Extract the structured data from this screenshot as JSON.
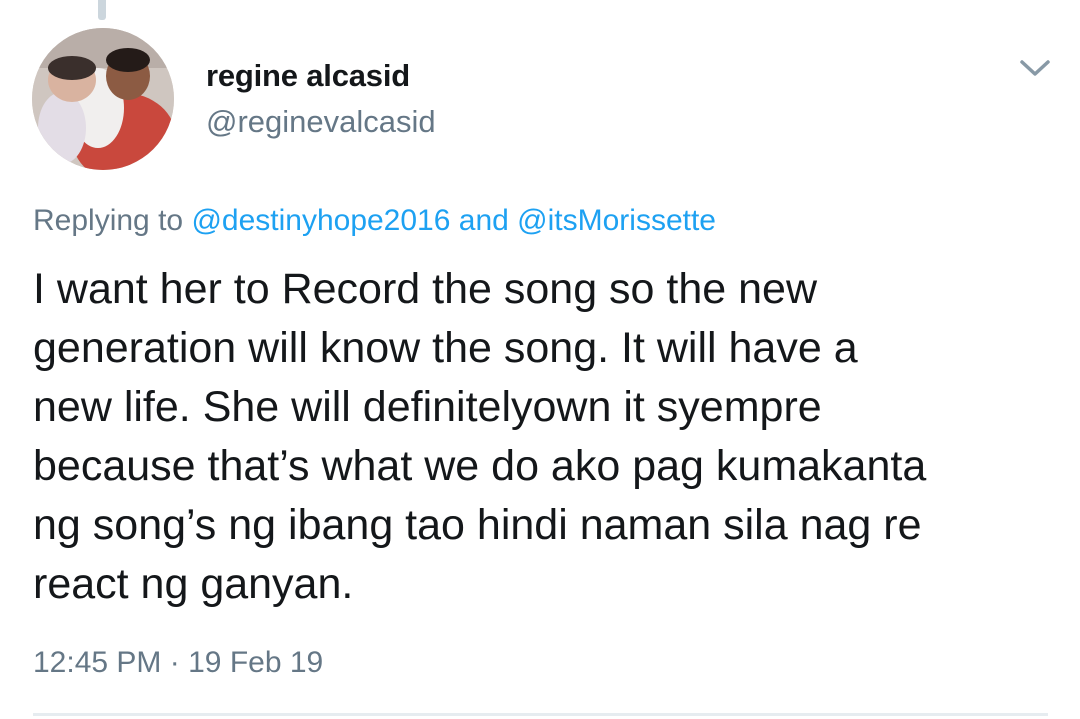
{
  "tweet": {
    "author_name": "regine alcasid",
    "author_handle": "@reginevalcasid",
    "replying_prefix": "Replying to",
    "reply_mentions": [
      "@destinyhope2016",
      "@itsMorissette"
    ],
    "reply_conjunction": "and",
    "text_lines": [
      "I want her to Record the song so the new",
      "generation will know the song. It will have a",
      "new life. She will definitelyown it syempre",
      "because that’s what we do ako pag kumakanta",
      "ng song’s ng ibang tao hindi naman sila nag re",
      "react ng ganyan."
    ],
    "time": "12:45 PM",
    "separator": "·",
    "date": "19 Feb 19"
  },
  "icons": {
    "menu": "chevron-down-icon"
  },
  "colors": {
    "text": "#14171a",
    "secondary": "#657786",
    "accent": "#1da1f2"
  }
}
